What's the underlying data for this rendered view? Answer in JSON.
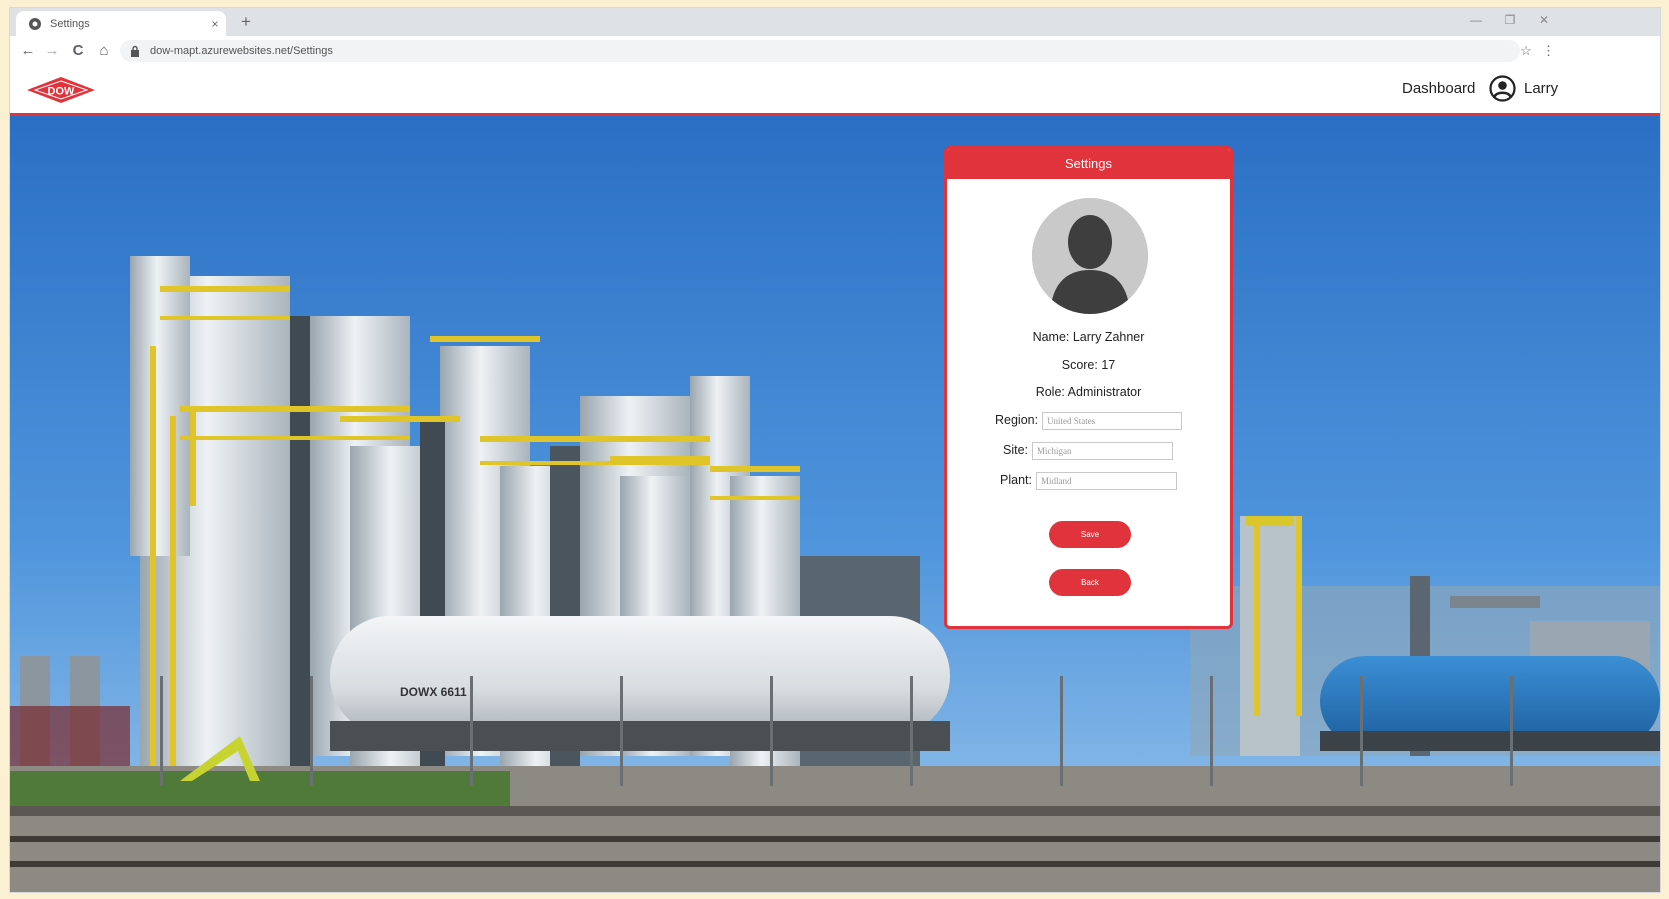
{
  "browser": {
    "tab_title": "Settings",
    "tab_close": "×",
    "new_tab": "+",
    "address_url": "dow-mapt.azurewebsites.net/Settings",
    "controls": {
      "minimize": "—",
      "restore": "❐",
      "close": "✕"
    },
    "nav": {
      "back": "←",
      "forward": "→",
      "reload": "C",
      "home": "⌂",
      "bookmark": "☆",
      "menu": "⋮"
    }
  },
  "header": {
    "logo_text": "DOW",
    "nav_dashboard": "Dashboard",
    "user_name": "Larry",
    "accent_color": "#e1333b"
  },
  "settings": {
    "title": "Settings",
    "name_line": "Name: Larry Zahner",
    "score_line": "Score: 17",
    "role_line": "Role: Administrator",
    "fields": {
      "region": {
        "label": "Region:",
        "placeholder": "United States"
      },
      "site": {
        "label": "Site:",
        "placeholder": "Michigan"
      },
      "plant": {
        "label": "Plant:",
        "placeholder": "Midland"
      }
    },
    "save_label": "Save",
    "back_label": "Back"
  },
  "hero": {
    "railcar_marking": "DOWX 6611"
  }
}
